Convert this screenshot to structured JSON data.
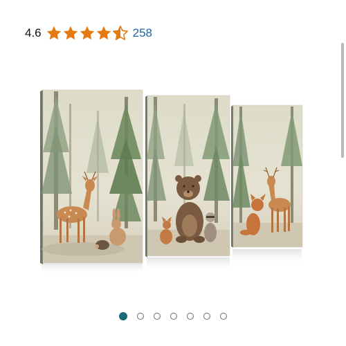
{
  "rating": {
    "value": "4.6",
    "stars": [
      {
        "fill": 1
      },
      {
        "fill": 1
      },
      {
        "fill": 1
      },
      {
        "fill": 1
      },
      {
        "fill": 0.5
      }
    ],
    "review_count": "258",
    "star_color": "#e47911"
  },
  "image": {
    "icon": "woodland-animals-canvas-triptych"
  },
  "carousel": {
    "total": 7,
    "active_index": 0,
    "active_color": "#1a6a79"
  }
}
